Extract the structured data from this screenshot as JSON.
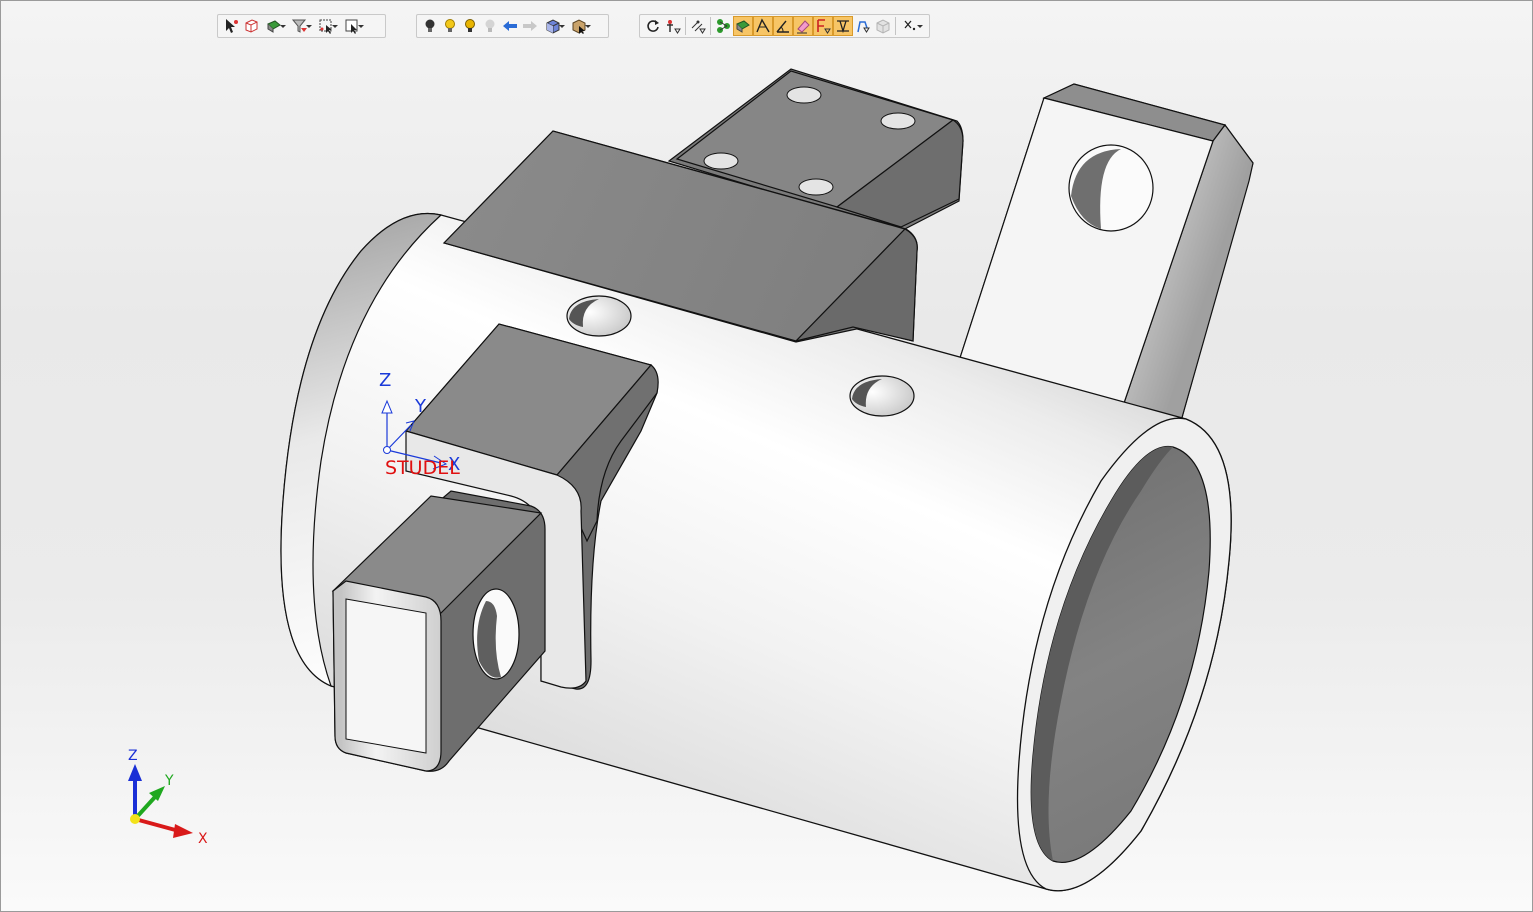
{
  "toolbars": {
    "selection": {
      "buttons": [
        "select-icon",
        "select-body-icon",
        "select-face-icon",
        "filter-icon",
        "box-select-icon",
        "pick-icon"
      ]
    },
    "view": {
      "buttons": [
        "light-off-icon",
        "light-on-icon",
        "light-bulb-icon",
        "light-disabled-icon",
        "back-arrow-icon",
        "forward-arrow-icon",
        "view-cube-icon",
        "camera-icon"
      ]
    },
    "tools": {
      "buttons": [
        "rotate-icon",
        "pin-tool-icon",
        "measure-icon",
        "dimension-icon",
        "sketch-face-icon",
        "edit-icon",
        "angle-icon",
        "eraser-icon",
        "constraint-icon",
        "align-icon",
        "shape-icon",
        "disabled-cube-icon",
        "close-menu-icon"
      ]
    }
  },
  "model": {
    "ucs_labels": {
      "z": "Z",
      "y": "Y",
      "x": "X",
      "origin_label": "STUDEL"
    },
    "colors": {
      "z_axis": "#1a2fd6",
      "y_axis": "#1fa81f",
      "x_axis": "#d91a1a",
      "origin_text": "#e01010",
      "ucs_blue": "#1a3ad9"
    }
  },
  "triad": {
    "z": "Z",
    "y": "Y",
    "x": "X"
  }
}
